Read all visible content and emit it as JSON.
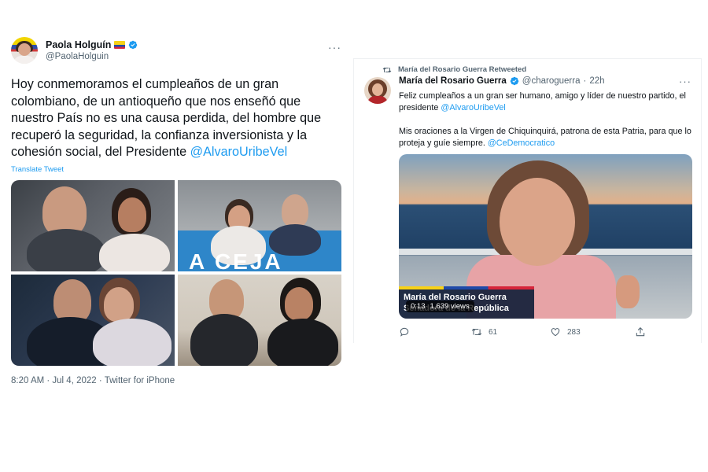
{
  "left_tweet": {
    "author_name": "Paola Holguín",
    "flag_emoji": "colombia-flag",
    "handle": "@PaolaHolguin",
    "more": "···",
    "text_before_mention": "Hoy conmemoramos el cumpleaños de un gran colombiano, de un antioqueño que nos enseñó que nuestro País no es una causa perdida, del hombre que recuperó la seguridad, la confianza inversionista y la cohesión social, del Presidente ",
    "mention": "@AlvaroUribeVel",
    "translate_label": "Translate Tweet",
    "banner_text": "A CEJA",
    "meta": "8:20 AM · Jul 4, 2022 · Twitter for iPhone"
  },
  "right_tweet": {
    "retweet_label": "María del Rosario Guerra Retweeted",
    "author_name": "María del Rosario Guerra",
    "handle": "@charoguerra",
    "separator": "·",
    "time": "22h",
    "more": "···",
    "para1_text": "Feliz cumpleaños a un gran ser humano, amigo y líder de nuestro partido, el presidente ",
    "para1_mention": "@AlvaroUribeVel",
    "para2_text": "Mis oraciones a la Virgen de Chiquinquirá, patrona de esta Patria, para que lo proteja y guíe siempre. ",
    "para2_mention": "@CeDemocratico",
    "video": {
      "caption_name": "María del Rosario Guerra",
      "caption_role": "Senadora de la República",
      "time": "0:13",
      "views": "1,639 views"
    },
    "actions": {
      "reply_count": "",
      "retweet_count": "61",
      "like_count": "283"
    }
  },
  "colors": {
    "link": "#1d9bf0",
    "secondary_text": "#536471",
    "primary_text": "#0f1419",
    "verified": "#1d9bf0"
  }
}
